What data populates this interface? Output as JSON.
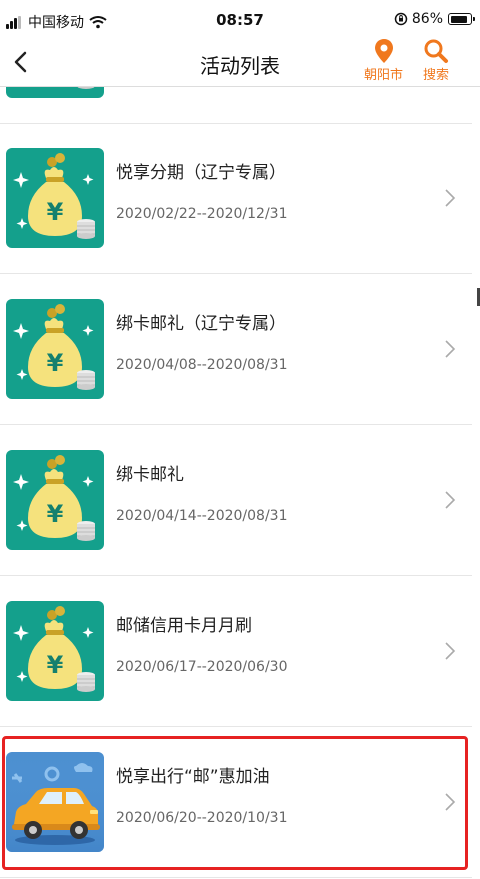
{
  "status": {
    "carrier": "中国移动",
    "time": "08:57",
    "battery": "86%",
    "battery_level": 0.86
  },
  "nav": {
    "title": "活动列表",
    "location": "朝阳市",
    "search": "搜索"
  },
  "items": [
    {
      "title": "悦享分期（辽宁专属）",
      "date": "2020/02/22--2020/12/31",
      "image": "money-bag"
    },
    {
      "title": "绑卡邮礼（辽宁专属）",
      "date": "2020/04/08--2020/08/31",
      "image": "money-bag"
    },
    {
      "title": "绑卡邮礼",
      "date": "2020/04/14--2020/08/31",
      "image": "money-bag"
    },
    {
      "title": "邮储信用卡月月刷",
      "date": "2020/06/17--2020/06/30",
      "image": "money-bag"
    },
    {
      "title": "悦享出行“邮”惠加油",
      "date": "2020/06/20--2020/10/31",
      "image": "car"
    }
  ],
  "colors": {
    "accent": "#f0781e",
    "thumb_bg": "#14a08c",
    "highlight": "#e62222"
  }
}
